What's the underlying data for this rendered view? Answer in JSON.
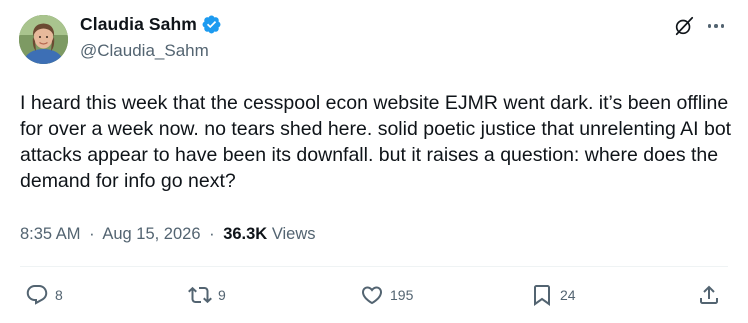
{
  "author": {
    "display_name": "Claudia Sahm",
    "handle": "@Claudia_Sahm",
    "verified": true
  },
  "tweet": {
    "text": "I heard this week that the cesspool econ website EJMR went dark. it’s been offline for over a week now. no tears shed here. solid poetic justice that unrelenting AI bot attacks appear to have been its downfall. but it raises a question: where does the demand for info go next?"
  },
  "meta": {
    "time": "8:35 AM",
    "separator": "·",
    "date": "Aug 15, 2026",
    "views_count": "36.3K",
    "views_label": "Views"
  },
  "actions": {
    "replies": "8",
    "reposts": "9",
    "likes": "195",
    "bookmarks": "24"
  },
  "colors": {
    "text": "#0f1419",
    "secondary": "#536471",
    "verified": "#1d9bf0"
  },
  "icons": [
    "avatar",
    "verified-badge-icon",
    "grok-icon",
    "more-icon",
    "reply-icon",
    "repost-icon",
    "like-icon",
    "bookmark-icon",
    "share-icon"
  ]
}
